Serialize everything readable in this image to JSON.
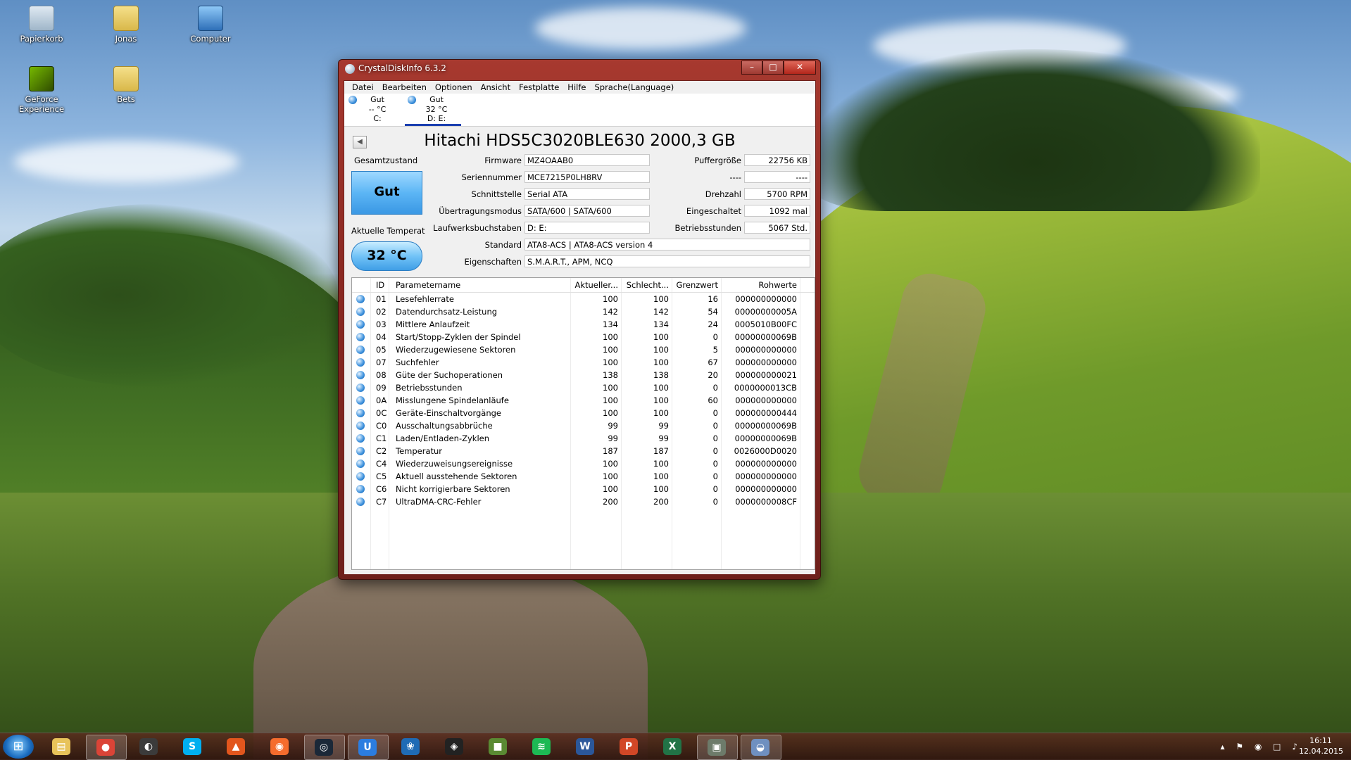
{
  "desktop": {
    "icons": [
      {
        "label": "Papierkorb",
        "icon": "recycle-bin-icon"
      },
      {
        "label": "Jonas",
        "icon": "user-folder-icon"
      },
      {
        "label": "Computer",
        "icon": "computer-icon"
      },
      {
        "label": "GeForce Experience",
        "icon": "nvidia-icon"
      },
      {
        "label": "Bets",
        "icon": "folder-icon"
      }
    ]
  },
  "window": {
    "title": "CrystalDiskInfo 6.3.2",
    "minimize": "–",
    "maximize": "□",
    "close": "✕"
  },
  "menu": [
    "Datei",
    "Bearbeiten",
    "Optionen",
    "Ansicht",
    "Festplatte",
    "Hilfe",
    "Sprache(Language)"
  ],
  "drives": [
    {
      "status": "Gut",
      "temp": "-- °C",
      "letters": "C:"
    },
    {
      "status": "Gut",
      "temp": "32 °C",
      "letters": "D: E:"
    }
  ],
  "disk": {
    "title": "Hitachi HDS5C3020BLE630 2000,3 GB",
    "health_label": "Gesamtzustand",
    "health_value": "Gut",
    "temp_label": "Aktuelle Temperat",
    "temp_value": "32 °C",
    "firmware_label": "Firmware",
    "firmware": "MZ4OAAB0",
    "serial_label": "Seriennummer",
    "serial": "MCE7215P0LH8RV",
    "interface_label": "Schnittstelle",
    "interface": "Serial ATA",
    "transfer_label": "Übertragungsmodus",
    "transfer": "SATA/600 | SATA/600",
    "drive_letters_label": "Laufwerksbuchstaben",
    "drive_letters": "D: E:",
    "standard_label": "Standard",
    "standard": "ATA8-ACS | ATA8-ACS version 4",
    "features_label": "Eigenschaften",
    "features": "S.M.A.R.T., APM, NCQ",
    "buffer_label": "Puffergröße",
    "buffer": "22756 KB",
    "blank_label": "----",
    "blank": "----",
    "rpm_label": "Drehzahl",
    "rpm": "5700 RPM",
    "power_count_label": "Eingeschaltet",
    "power_count": "1092 mal",
    "power_hours_label": "Betriebsstunden",
    "power_hours": "5067 Std."
  },
  "smart": {
    "headers": [
      "ID",
      "Parametername",
      "Aktueller...",
      "Schlecht...",
      "Grenzwert",
      "Rohwerte"
    ],
    "rows": [
      [
        "01",
        "Lesefehlerrate",
        "100",
        "100",
        "16",
        "000000000000"
      ],
      [
        "02",
        "Datendurchsatz-Leistung",
        "142",
        "142",
        "54",
        "00000000005A"
      ],
      [
        "03",
        "Mittlere Anlaufzeit",
        "134",
        "134",
        "24",
        "0005010B00FC"
      ],
      [
        "04",
        "Start/Stopp-Zyklen der Spindel",
        "100",
        "100",
        "0",
        "00000000069B"
      ],
      [
        "05",
        "Wiederzugewiesene Sektoren",
        "100",
        "100",
        "5",
        "000000000000"
      ],
      [
        "07",
        "Suchfehler",
        "100",
        "100",
        "67",
        "000000000000"
      ],
      [
        "08",
        "Güte der Suchoperationen",
        "138",
        "138",
        "20",
        "000000000021"
      ],
      [
        "09",
        "Betriebsstunden",
        "100",
        "100",
        "0",
        "0000000013CB"
      ],
      [
        "0A",
        "Misslungene Spindelanläufe",
        "100",
        "100",
        "60",
        "000000000000"
      ],
      [
        "0C",
        "Geräte-Einschaltvorgänge",
        "100",
        "100",
        "0",
        "000000000444"
      ],
      [
        "C0",
        "Ausschaltungsabbrüche",
        "99",
        "99",
        "0",
        "00000000069B"
      ],
      [
        "C1",
        "Laden/Entladen-Zyklen",
        "99",
        "99",
        "0",
        "00000000069B"
      ],
      [
        "C2",
        "Temperatur",
        "187",
        "187",
        "0",
        "0026000D0020"
      ],
      [
        "C4",
        "Wiederzuweisungsereignisse",
        "100",
        "100",
        "0",
        "000000000000"
      ],
      [
        "C5",
        "Aktuell ausstehende Sektoren",
        "100",
        "100",
        "0",
        "000000000000"
      ],
      [
        "C6",
        "Nicht korrigierbare Sektoren",
        "100",
        "100",
        "0",
        "000000000000"
      ],
      [
        "C7",
        "UltraDMA-CRC-Fehler",
        "200",
        "200",
        "0",
        "0000000008CF"
      ]
    ]
  },
  "taskbar": {
    "apps": [
      {
        "name": "explorer-icon",
        "glyph": "▤",
        "color": "#e8c35a",
        "open": false
      },
      {
        "name": "chrome-icon",
        "glyph": "●",
        "color": "#db4437",
        "open": true
      },
      {
        "name": "media-app-icon",
        "glyph": "◐",
        "color": "#3b3b3b",
        "open": false
      },
      {
        "name": "skype-icon",
        "glyph": "S",
        "color": "#00aff0",
        "open": false
      },
      {
        "name": "flame-app-icon",
        "glyph": "▲",
        "color": "#e2561d",
        "open": false
      },
      {
        "name": "origin-icon",
        "glyph": "◉",
        "color": "#f56c2d",
        "open": false
      },
      {
        "name": "steam-icon",
        "glyph": "◎",
        "color": "#1b2838",
        "open": true
      },
      {
        "name": "uplay-icon",
        "glyph": "U",
        "color": "#2b7de0",
        "open": true
      },
      {
        "name": "battle-net-icon",
        "glyph": "❀",
        "color": "#1f6bb5",
        "open": false
      },
      {
        "name": "obs-icon",
        "glyph": "◈",
        "color": "#222222",
        "open": false
      },
      {
        "name": "minecraft-icon",
        "glyph": "■",
        "color": "#5a8a33",
        "open": false
      },
      {
        "name": "spotify-icon",
        "glyph": "≋",
        "color": "#1db954",
        "open": false
      },
      {
        "name": "word-icon",
        "glyph": "W",
        "color": "#2b579a",
        "open": false
      },
      {
        "name": "powerpoint-icon",
        "glyph": "P",
        "color": "#d24726",
        "open": false
      },
      {
        "name": "excel-icon",
        "glyph": "X",
        "color": "#217346",
        "open": false
      },
      {
        "name": "network-monitor-icon",
        "glyph": "▣",
        "color": "#6d7b6a",
        "open": true
      },
      {
        "name": "crystaldiskinfo-icon",
        "glyph": "◒",
        "color": "#6f90c0",
        "open": true
      }
    ],
    "tray_icons": "▴ ⚑ ◉ □ ♪",
    "time": "16:11",
    "date": "12.04.2015"
  }
}
